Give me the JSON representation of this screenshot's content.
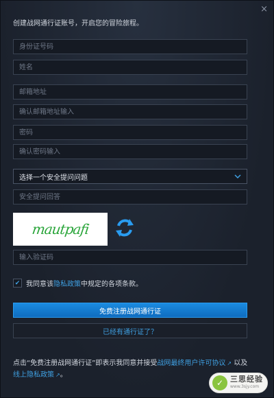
{
  "window": {
    "close_label": "×"
  },
  "heading": "创建战网通行证账号，开启您的冒险旅程。",
  "form": {
    "id_number_placeholder": "身份证号码",
    "name_placeholder": "姓名",
    "email_placeholder": "邮箱地址",
    "email_confirm_placeholder": "确认邮箱地址输入",
    "password_placeholder": "密码",
    "password_confirm_placeholder": "确认密码输入",
    "security_question_selected": "选择一个安全提问问题",
    "security_answer_placeholder": "安全提问回答",
    "captcha_text": "mautpafi",
    "captcha_input_placeholder": "输入验证码"
  },
  "agreement": {
    "checked": true,
    "prefix": "我同意该",
    "link": "隐私政策",
    "suffix": "中规定的各项条款。"
  },
  "buttons": {
    "register": "免费注册战网通行证",
    "have_account": "已经有通行证了？"
  },
  "footer": {
    "text_before": "点击“免费注册战网通行证”即表示我同意并接受",
    "eula_link": "战网最终用户许可协议",
    "text_middle": "以及",
    "privacy_link": "线上隐私政策",
    "text_end": "。"
  },
  "watermark": {
    "main": "三思经验",
    "sub": "www.3sjy.com"
  },
  "colors": {
    "accent": "#3f9fe0",
    "primary_button": "#1b8be0",
    "background": "#1d2330"
  },
  "icons": {
    "refresh": "refresh-icon",
    "close": "close-icon",
    "chevron": "chevron-down-icon",
    "external": "external-link-icon"
  }
}
